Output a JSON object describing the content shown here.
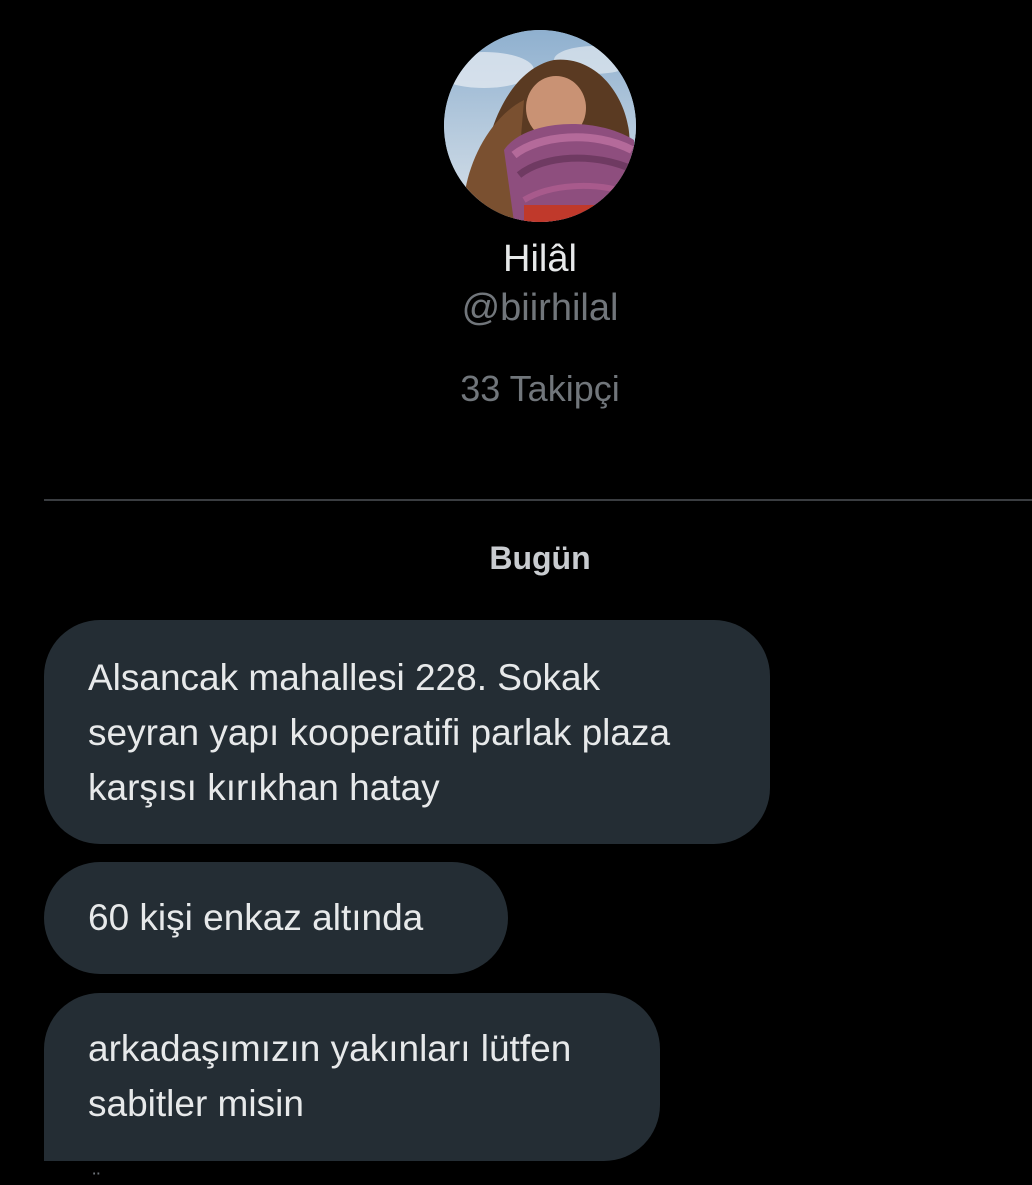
{
  "profile": {
    "display_name": "Hilâl",
    "handle": "@biirhilal",
    "followers": "33 Takipçi",
    "avatar_icon": "profile-photo"
  },
  "conversation": {
    "date_separator": "Bugün",
    "messages": [
      {
        "text": "Alsancak mahallesi 228. Sokak\nseyran yapı kooperatifi parlak plaza\nkarşısı kırıkhan hatay"
      },
      {
        "text": "60 kişi enkaz altında"
      },
      {
        "text": "arkadaşımızın yakınları lütfen\nsabitler misin"
      }
    ],
    "cutoff_text": "..̈"
  },
  "colors": {
    "background": "#000000",
    "bubble": "#242d34",
    "primary_text": "#e7e9ea",
    "secondary_text": "#71767b",
    "divider": "#3a3d41"
  }
}
